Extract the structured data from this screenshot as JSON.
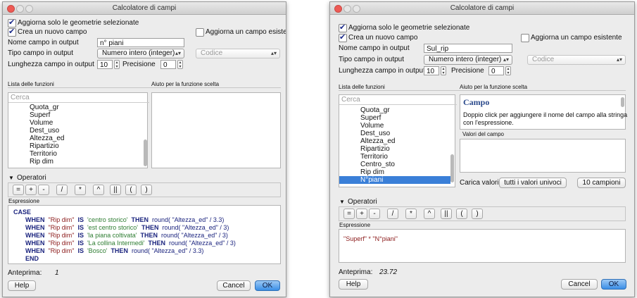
{
  "left": {
    "title": "Calcolatore di campi",
    "only_selected": "Aggiorna solo le geometrie selezionate",
    "create_new": "Crea un nuovo campo",
    "update_existing": "Aggiorna un campo esistente",
    "output_name_label": "Nome campo in output",
    "output_name_value": "n° piani",
    "output_type_label": "Tipo campo in output",
    "output_type_value": "Numero intero (integer)",
    "code_placeholder": "Codice",
    "length_label": "Lunghezza campo in output",
    "length_value": "10",
    "precision_label": "Precisione",
    "precision_value": "0",
    "functions_header": "Lista delle funzioni",
    "help_header": "Aiuto per la funzione scelta",
    "search_placeholder": "Cerca",
    "fields": [
      "Quota_gr",
      "Superf",
      "Volume",
      "Dest_uso",
      "Altezza_ed",
      "Ripartizio",
      "Territorio",
      "Rip dim"
    ],
    "operators_label": "Operatori",
    "operators": [
      "=",
      "+",
      "-",
      "/",
      "*",
      "^",
      "||",
      "(",
      ")"
    ],
    "expression_label": "Espressione",
    "expression": {
      "case": "CASE",
      "when": "WHEN",
      "is": "IS",
      "then": "THEN",
      "end": "END",
      "field": "\"Rip dim\"",
      "rows": [
        {
          "value": "'centro storico'",
          "result": "round( \"Altezza_ed\"  / 3.3)"
        },
        {
          "value": "'est centro storico'",
          "result": "round( \"Altezza_ed\" / 3)"
        },
        {
          "value": "'la piana coltivata'",
          "result": "round( \"Altezza_ed\"  / 3)"
        },
        {
          "value": "'La collina Intermedi'",
          "result": "round( \"Altezza_ed\"  / 3)"
        },
        {
          "value": "'Bosco'",
          "result": "round( \"Altezza_ed\" / 3.3)"
        }
      ]
    },
    "preview_label": "Anteprima:",
    "preview_value": "1",
    "help_button": "Help",
    "cancel_button": "Cancel",
    "ok_button": "OK"
  },
  "right": {
    "title": "Calcolatore di campi",
    "only_selected": "Aggiorna solo le geometrie selezionate",
    "create_new": "Crea un nuovo campo",
    "update_existing": "Aggiorna un campo esistente",
    "output_name_label": "Nome campo in output",
    "output_name_value": "Sul_rip",
    "output_type_label": "Tipo campo in output",
    "output_type_value": "Numero intero (integer)",
    "code_placeholder": "Codice",
    "length_label": "Lunghezza campo in output",
    "length_value": "10",
    "precision_label": "Precisione",
    "precision_value": "0",
    "functions_header": "Lista delle funzioni",
    "help_header": "Aiuto per la funzione scelta",
    "search_placeholder": "Cerca",
    "fields": [
      "Quota_gr",
      "Superf",
      "Volume",
      "Dest_uso",
      "Altezza_ed",
      "Ripartizio",
      "Territorio",
      "Centro_sto",
      "Rip dim",
      "N°piani"
    ],
    "selected_field": "N°piani",
    "help_title": "Campo",
    "help_text_1": "Doppio click per aggiungere il nome del campo alla stringa",
    "help_text_2": "con l'espressione.",
    "field_values_label": "Valori del campo",
    "load_values_label": "Carica valori",
    "all_unique_button": "tutti i valori univoci",
    "ten_samples_button": "10 campioni",
    "operators_label": "Operatori",
    "operators": [
      "=",
      "+",
      "-",
      "/",
      "*",
      "^",
      "||",
      "(",
      ")"
    ],
    "expression_label": "Espressione",
    "expression_text": "\"Superf\" * \"N°piani\"",
    "preview_label": "Anteprima:",
    "preview_value": "23.72",
    "help_button": "Help",
    "cancel_button": "Cancel",
    "ok_button": "OK"
  },
  "colors": {
    "keyword": "#1a237e",
    "field": "#8b1a1a",
    "string": "#2e7d32",
    "selection": "#3a7fd8",
    "ok_button": "#3a8ee6",
    "close_light": "#ee5a55"
  }
}
